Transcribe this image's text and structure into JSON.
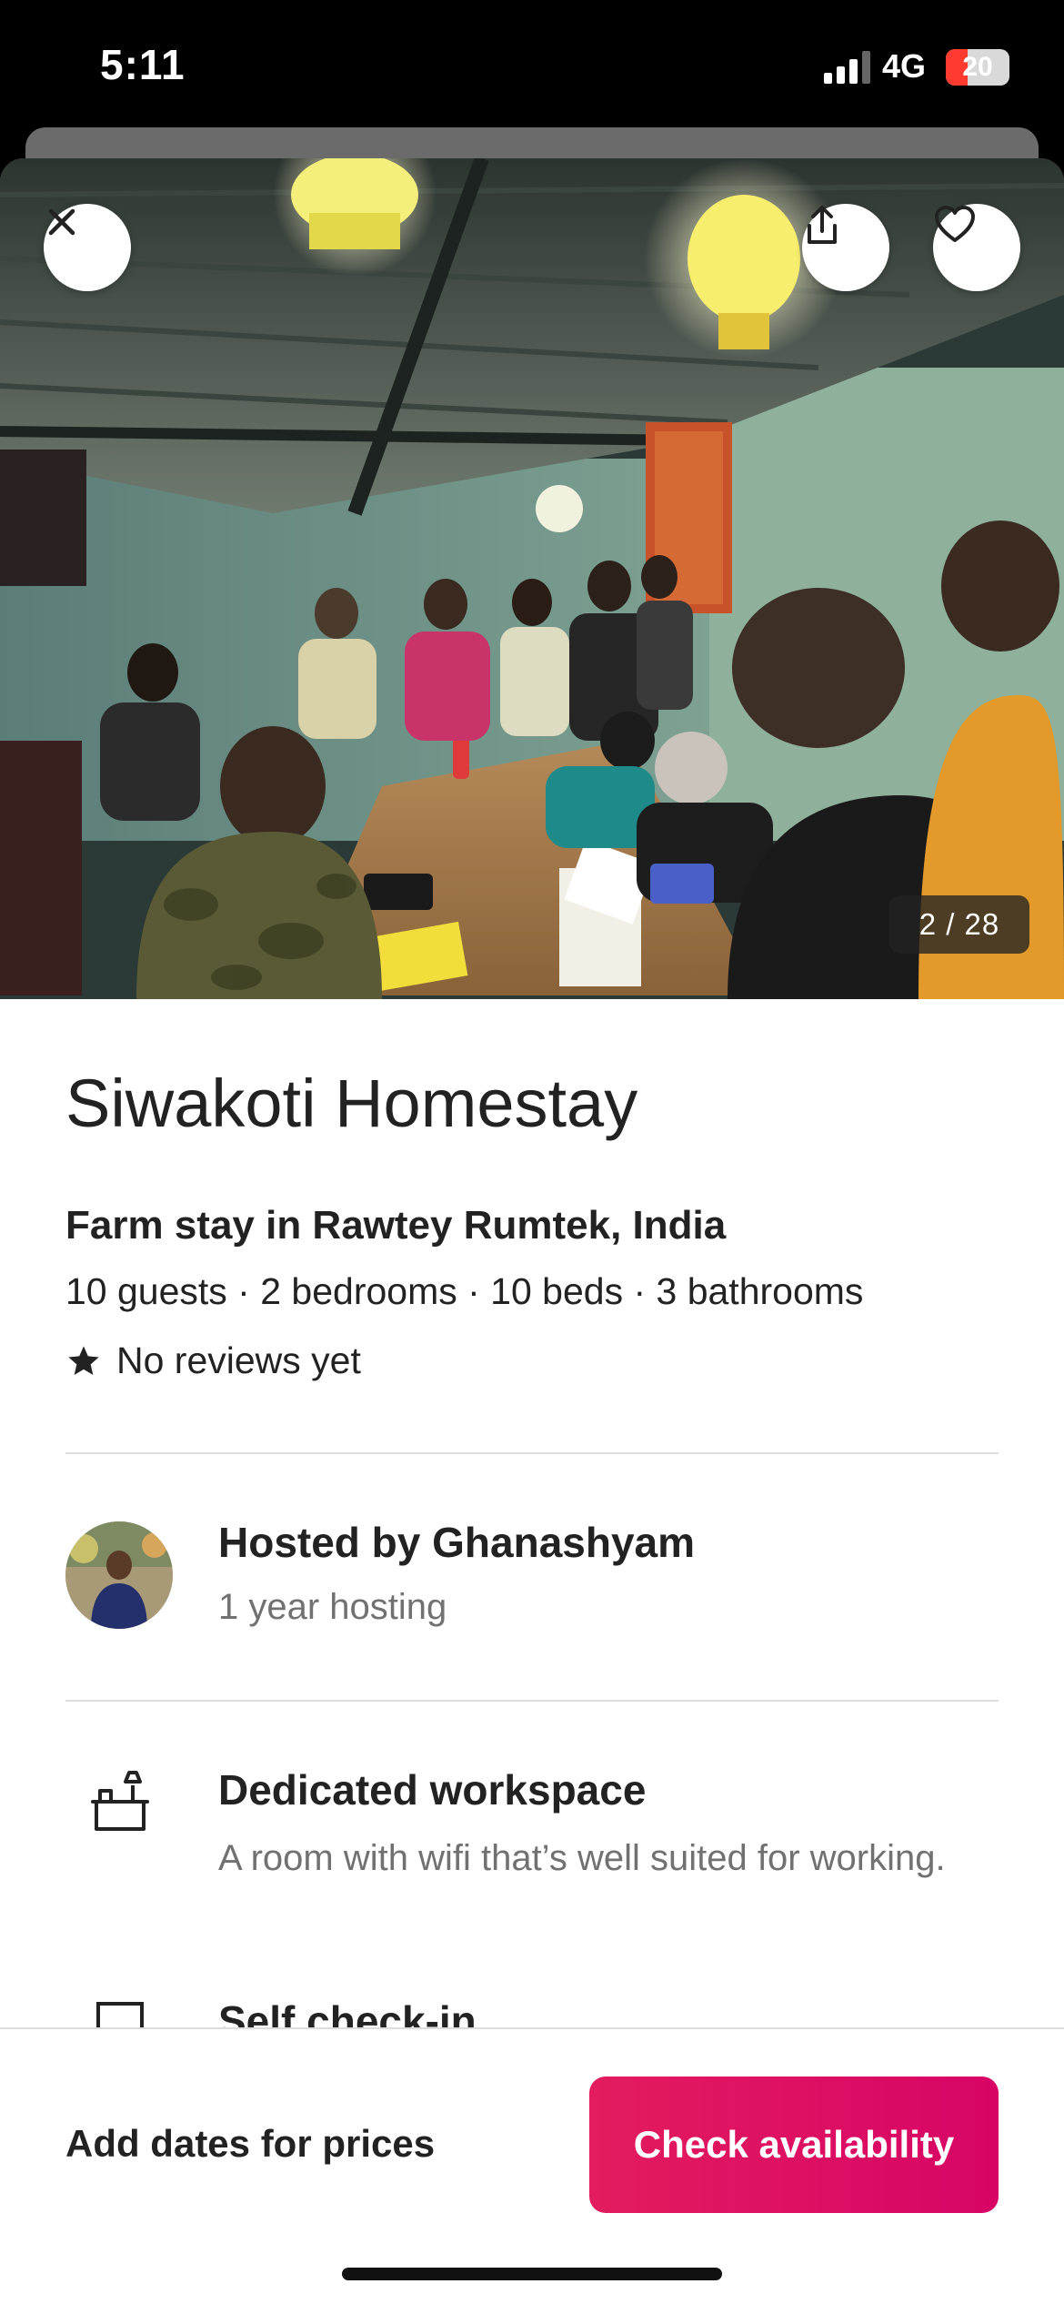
{
  "status_bar": {
    "time": "5:11",
    "network": "4G",
    "battery": "20",
    "battery_level": 0.2,
    "signal_bars": 3
  },
  "photo": {
    "counter": "2 / 28",
    "close_icon": "close-icon",
    "share_icon": "share-icon",
    "favorite_icon": "heart-icon"
  },
  "listing": {
    "title": "Siwakoti Homestay",
    "subtitle": "Farm stay in Rawtey Rumtek, India",
    "details": "10 guests · 2 bedrooms · 10 beds · 3 bathrooms",
    "reviews": "No reviews yet"
  },
  "host": {
    "name": "Hosted by Ghanashyam",
    "years": "1 year hosting"
  },
  "features": [
    {
      "icon": "desk-icon",
      "title": "Dedicated workspace",
      "description": "A room with wifi that’s well suited for working."
    },
    {
      "icon": "door-icon",
      "title": "Self check-in"
    }
  ],
  "footer": {
    "add_dates": "Add dates for prices",
    "check_availability": "Check availability"
  },
  "colors": {
    "accent": "#E31C5F",
    "text_primary": "#222222",
    "text_secondary": "#717171",
    "divider": "#DDDDDD"
  }
}
